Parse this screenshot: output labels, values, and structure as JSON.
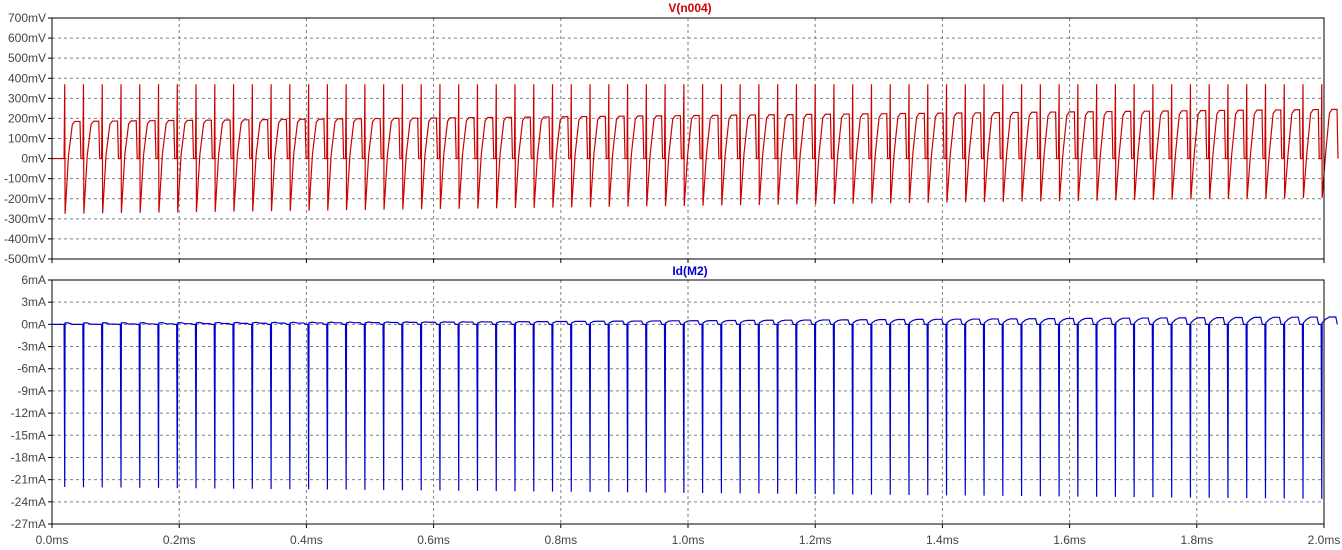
{
  "x_ticks": [
    "0.0ms",
    "0.2ms",
    "0.4ms",
    "0.6ms",
    "0.8ms",
    "1.0ms",
    "1.2ms",
    "1.4ms",
    "1.6ms",
    "1.8ms",
    "2.0ms"
  ],
  "chart_data": [
    {
      "type": "line",
      "title": "V(n004)",
      "color": "#cc0000",
      "xlim": [
        0,
        2.0
      ],
      "x_unit": "ms",
      "ylim": [
        -500,
        700
      ],
      "y_unit": "mV",
      "y_ticks": [
        "700mV",
        "600mV",
        "500mV",
        "400mV",
        "300mV",
        "200mV",
        "100mV",
        "0mV",
        "-100mV",
        "-200mV",
        "-300mV",
        "-400mV",
        "-500mV"
      ],
      "grid": true,
      "period_ms": 0.0295,
      "cycles": 68,
      "series": [
        {
          "spike_peak_mV": 370,
          "plateau_start_mV": 185,
          "plateau_end_mV": 245,
          "trough_start_mV": -275,
          "trough_end_mV": -195
        }
      ]
    },
    {
      "type": "line",
      "title": "Id(M2)",
      "color": "#0000cc",
      "xlim": [
        0,
        2.0
      ],
      "x_unit": "ms",
      "ylim": [
        -27,
        6
      ],
      "y_unit": "mA",
      "y_ticks": [
        "6mA",
        "3mA",
        "0mA",
        "-3mA",
        "-6mA",
        "-9mA",
        "-12mA",
        "-15mA",
        "-18mA",
        "-21mA",
        "-24mA",
        "-27mA"
      ],
      "grid": true,
      "period_ms": 0.0295,
      "cycles": 68,
      "series": [
        {
          "spike_min_start_mA": -22.0,
          "spike_min_end_mA": -23.6,
          "baseline_mA": 0.0,
          "bump_end_mA": 1.0
        }
      ]
    }
  ]
}
